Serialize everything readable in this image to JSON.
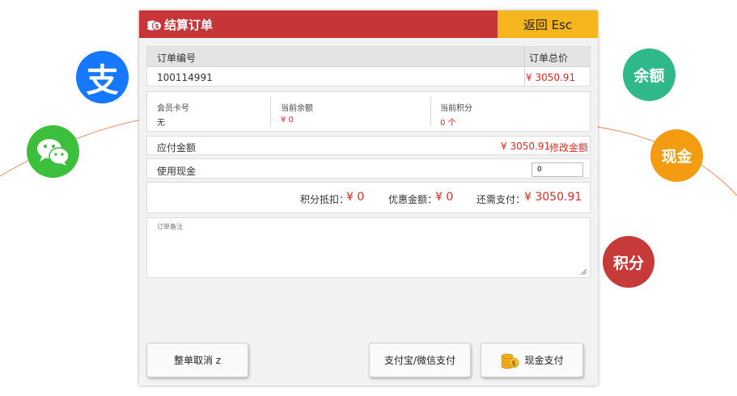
{
  "colors": {
    "title_bar": "#c83538",
    "back_button": "#f5b51c",
    "accent_red": "#e02a1f",
    "alipay": "#1677ff",
    "wechat": "#3cbf3c",
    "balance": "#2fb88a",
    "cash": "#f39c12",
    "points": "#c63a3a",
    "deco_line": "#f08a5d"
  },
  "decorations": {
    "alipay_icon": "alipay-icon",
    "alipay_glyph": "支",
    "wechat_icon": "wechat-icon",
    "balance_label": "余额",
    "cash_label": "现金",
    "points_label": "积分"
  },
  "dialog": {
    "title": "结算订单",
    "title_icon": "coins-icon",
    "back_label": "返回 Esc",
    "order": {
      "no_label": "订单编号",
      "no_value": "100114991",
      "total_label": "订单总价",
      "total_value": "¥ 3050.91"
    },
    "member": {
      "card_label": "会员卡号",
      "card_value": "无",
      "balance_label": "当前余额",
      "balance_value": "¥ 0",
      "points_label": "当前积分",
      "points_value": "0 个"
    },
    "due": {
      "label": "应付金额",
      "value": "¥ 3050.91",
      "edit_label": "修改金额"
    },
    "cash": {
      "label": "使用现金",
      "input_value": "0"
    },
    "summary": {
      "points_label": "积分抵扣：",
      "points_value": "¥ 0",
      "discount_label": "优惠金额：",
      "discount_value": "¥ 0",
      "remaining_label": "还需支付：",
      "remaining_value": "¥ 3050.91"
    },
    "remark": {
      "placeholder": "订单备注"
    },
    "buttons": {
      "cancel": "整单取消 z",
      "alipay_wechat": "支付宝/微信支付",
      "cash_pay": "现金支付"
    }
  }
}
